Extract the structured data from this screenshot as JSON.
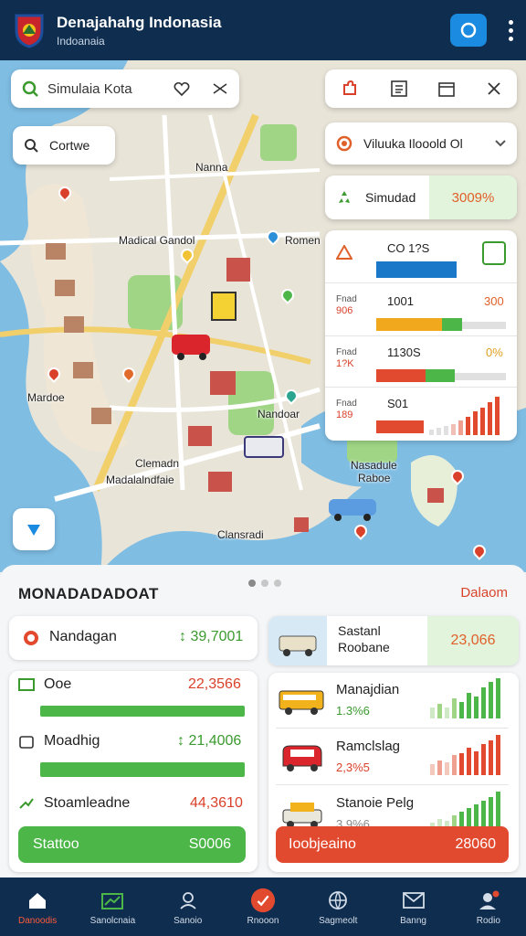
{
  "header": {
    "title": "Denajahahg Indonasia",
    "subtitle": "Indoanaia",
    "search_icon": "search-icon",
    "menu_icon": "more-vertical-icon"
  },
  "map": {
    "search_text": "Simulaia Kota",
    "center_button": "Cortwe",
    "layer_dropdown": "Viluuka Ilooold Ol",
    "sim_label": "Simudad",
    "sim_value": "3009%",
    "labels": {
      "nanna": "Nanna",
      "madical": "Madical Gandol",
      "romen": "Romen",
      "mardoe": "Mardoe",
      "nandoar": "Nandoar",
      "clemadn": "Clemadn",
      "madalalndfa": "Madalalndfaie",
      "nasadule": "Nasadule",
      "raboe": "Raboe",
      "clansradi": "Clansradi"
    },
    "stats": {
      "row1": {
        "code": "CO 1?S"
      },
      "row2": {
        "small": "Fnad",
        "code": "906",
        "value": "1001",
        "pct": "300"
      },
      "row3": {
        "small": "Fnad",
        "code": "1?K",
        "value": "1130S",
        "pct": "0%"
      },
      "row4": {
        "small": "Fnad",
        "code": "189",
        "value": "S01"
      }
    }
  },
  "panel": {
    "title": "MONADADADOAT",
    "link": "Dalaom",
    "left_top": {
      "label": "Nandagan",
      "value": "↕ 39,7001"
    },
    "metrics": [
      {
        "label": "Ooe",
        "value": "22,3566"
      },
      {
        "label": "Moadhig",
        "value": "↕ 21,4006"
      },
      {
        "label": "Stoamleadne",
        "value": "44,3610"
      }
    ],
    "green_button": {
      "label": "Stattoo",
      "value": "S0006"
    },
    "right_top": {
      "label1": "Sastanl",
      "label2": "Roobane",
      "value": "23,066"
    },
    "vehicles": [
      {
        "name": "Manajdian",
        "pct": "1.3%6"
      },
      {
        "name": "Ramclslag",
        "pct": "2,3%5"
      },
      {
        "name": "Stanoie Pelg",
        "pct": "3,9%6"
      }
    ],
    "red_button": {
      "label": "Ioobjeaino",
      "value": "28060"
    }
  },
  "nav": [
    {
      "label": "Danoodis",
      "icon": "home-icon"
    },
    {
      "label": "Sanolcnaia",
      "icon": "chart-icon"
    },
    {
      "label": "Sanoio",
      "icon": "users-icon"
    },
    {
      "label": "Rnooon",
      "icon": "swap-icon"
    },
    {
      "label": "Sagmeolt",
      "icon": "globe-icon"
    },
    {
      "label": "Banng",
      "icon": "mail-icon"
    },
    {
      "label": "Rodio",
      "icon": "profile-icon"
    }
  ],
  "colors": {
    "navy": "#0f2d4f",
    "accent_blue": "#1a8be0",
    "green": "#4cb648",
    "red": "#e24a2f"
  }
}
